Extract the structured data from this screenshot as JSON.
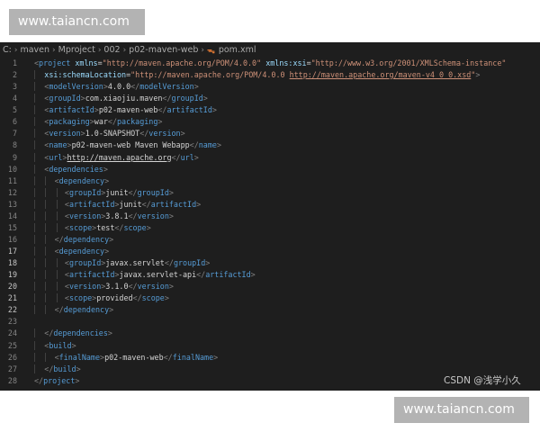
{
  "watermarks": {
    "top": "www.taiancn.com",
    "bottom": "www.taiancn.com"
  },
  "breadcrumb": [
    "C:",
    "maven",
    "Mproject",
    "002",
    "p02-maven-web",
    "pom.xml"
  ],
  "credit": "CSDN @浅学小久",
  "lines": [
    {
      "n": "1",
      "indent": 0,
      "tokens": [
        [
          "t",
          "<"
        ],
        [
          "tn",
          "project"
        ],
        [
          "tx",
          " "
        ],
        [
          "an",
          "xmlns"
        ],
        [
          "tx",
          "="
        ],
        [
          "av",
          "\"http://maven.apache.org/POM/4.0.0\""
        ],
        [
          "tx",
          " "
        ],
        [
          "an",
          "xmlns:xsi"
        ],
        [
          "tx",
          "="
        ],
        [
          "av",
          "\"http://www.w3.org/2001/XMLSchema-instance\""
        ]
      ]
    },
    {
      "n": "2",
      "indent": 1,
      "tokens": [
        [
          "an",
          "xsi:schemaLocation"
        ],
        [
          "tx",
          "="
        ],
        [
          "av",
          "\"http://maven.apache.org/POM/4.0.0 "
        ],
        [
          "av u",
          "http://maven.apache.org/maven-v4_0_0.xsd"
        ],
        [
          "av",
          "\""
        ],
        [
          "t",
          ">"
        ]
      ]
    },
    {
      "n": "3",
      "indent": 1,
      "tokens": [
        [
          "t",
          "<"
        ],
        [
          "tn",
          "modelVersion"
        ],
        [
          "t",
          ">"
        ],
        [
          "tx",
          "4.0.0"
        ],
        [
          "t",
          "</"
        ],
        [
          "tn",
          "modelVersion"
        ],
        [
          "t",
          ">"
        ]
      ]
    },
    {
      "n": "4",
      "indent": 1,
      "tokens": [
        [
          "t",
          "<"
        ],
        [
          "tn",
          "groupId"
        ],
        [
          "t",
          ">"
        ],
        [
          "tx",
          "com.xiaojiu.maven"
        ],
        [
          "t",
          "</"
        ],
        [
          "tn",
          "groupId"
        ],
        [
          "t",
          ">"
        ]
      ]
    },
    {
      "n": "5",
      "indent": 1,
      "tokens": [
        [
          "t",
          "<"
        ],
        [
          "tn",
          "artifactId"
        ],
        [
          "t",
          ">"
        ],
        [
          "tx",
          "p02-maven-web"
        ],
        [
          "t",
          "</"
        ],
        [
          "tn",
          "artifactId"
        ],
        [
          "t",
          ">"
        ]
      ]
    },
    {
      "n": "6",
      "indent": 1,
      "tokens": [
        [
          "t",
          "<"
        ],
        [
          "tn",
          "packaging"
        ],
        [
          "t",
          ">"
        ],
        [
          "tx",
          "war"
        ],
        [
          "t",
          "</"
        ],
        [
          "tn",
          "packaging"
        ],
        [
          "t",
          ">"
        ]
      ]
    },
    {
      "n": "7",
      "indent": 1,
      "tokens": [
        [
          "t",
          "<"
        ],
        [
          "tn",
          "version"
        ],
        [
          "t",
          ">"
        ],
        [
          "tx",
          "1.0-SNAPSHOT"
        ],
        [
          "t",
          "</"
        ],
        [
          "tn",
          "version"
        ],
        [
          "t",
          ">"
        ]
      ]
    },
    {
      "n": "8",
      "indent": 1,
      "tokens": [
        [
          "t",
          "<"
        ],
        [
          "tn",
          "name"
        ],
        [
          "t",
          ">"
        ],
        [
          "tx",
          "p02-maven-web Maven Webapp"
        ],
        [
          "t",
          "</"
        ],
        [
          "tn",
          "name"
        ],
        [
          "t",
          ">"
        ]
      ]
    },
    {
      "n": "9",
      "indent": 1,
      "tokens": [
        [
          "t",
          "<"
        ],
        [
          "tn",
          "url"
        ],
        [
          "t",
          ">"
        ],
        [
          "tx u",
          "http://maven.apache.org"
        ],
        [
          "t",
          "</"
        ],
        [
          "tn",
          "url"
        ],
        [
          "t",
          ">"
        ]
      ]
    },
    {
      "n": "10",
      "indent": 1,
      "tokens": [
        [
          "t",
          "<"
        ],
        [
          "tn",
          "dependencies"
        ],
        [
          "t",
          ">"
        ]
      ]
    },
    {
      "n": "11",
      "indent": 2,
      "tokens": [
        [
          "t",
          "<"
        ],
        [
          "tn",
          "dependency"
        ],
        [
          "t",
          ">"
        ]
      ]
    },
    {
      "n": "12",
      "indent": 3,
      "tokens": [
        [
          "t",
          "<"
        ],
        [
          "tn",
          "groupId"
        ],
        [
          "t",
          ">"
        ],
        [
          "tx",
          "junit"
        ],
        [
          "t",
          "</"
        ],
        [
          "tn",
          "groupId"
        ],
        [
          "t",
          ">"
        ]
      ]
    },
    {
      "n": "13",
      "indent": 3,
      "tokens": [
        [
          "t",
          "<"
        ],
        [
          "tn",
          "artifactId"
        ],
        [
          "t",
          ">"
        ],
        [
          "tx",
          "junit"
        ],
        [
          "t",
          "</"
        ],
        [
          "tn",
          "artifactId"
        ],
        [
          "t",
          ">"
        ]
      ]
    },
    {
      "n": "14",
      "indent": 3,
      "tokens": [
        [
          "t",
          "<"
        ],
        [
          "tn",
          "version"
        ],
        [
          "t",
          ">"
        ],
        [
          "tx",
          "3.8.1"
        ],
        [
          "t",
          "</"
        ],
        [
          "tn",
          "version"
        ],
        [
          "t",
          ">"
        ]
      ]
    },
    {
      "n": "15",
      "indent": 3,
      "tokens": [
        [
          "t",
          "<"
        ],
        [
          "tn",
          "scope"
        ],
        [
          "t",
          ">"
        ],
        [
          "tx",
          "test"
        ],
        [
          "t",
          "</"
        ],
        [
          "tn",
          "scope"
        ],
        [
          "t",
          ">"
        ]
      ]
    },
    {
      "n": "16",
      "indent": 2,
      "tokens": [
        [
          "t",
          "</"
        ],
        [
          "tn",
          "dependency"
        ],
        [
          "t",
          ">"
        ]
      ]
    },
    {
      "n": "17",
      "indent": 2,
      "sel": "full",
      "tokens": [
        [
          "t",
          "<"
        ],
        [
          "tn",
          "dependency"
        ],
        [
          "t",
          ">"
        ]
      ]
    },
    {
      "n": "18",
      "indent": 3,
      "sel": "dots",
      "tokens": [
        [
          "t",
          "<"
        ],
        [
          "tn",
          "groupId"
        ],
        [
          "t",
          ">"
        ],
        [
          "tx",
          "javax.servlet"
        ],
        [
          "t",
          "</"
        ],
        [
          "tn",
          "groupId"
        ],
        [
          "t",
          ">"
        ]
      ]
    },
    {
      "n": "19",
      "indent": 3,
      "sel": "dots",
      "tokens": [
        [
          "t",
          "<"
        ],
        [
          "tn",
          "artifactId"
        ],
        [
          "t",
          ">"
        ],
        [
          "tx",
          "javax.servlet-api"
        ],
        [
          "t",
          "</"
        ],
        [
          "tn",
          "artifactId"
        ],
        [
          "t",
          ">"
        ]
      ]
    },
    {
      "n": "20",
      "indent": 3,
      "sel": "dots",
      "tokens": [
        [
          "t",
          "<"
        ],
        [
          "tn",
          "version"
        ],
        [
          "t",
          ">"
        ],
        [
          "tx",
          "3.1.0"
        ],
        [
          "t",
          "</"
        ],
        [
          "tn",
          "version"
        ],
        [
          "t",
          ">"
        ]
      ]
    },
    {
      "n": "21",
      "indent": 3,
      "sel": "dots",
      "tokens": [
        [
          "t",
          "<"
        ],
        [
          "tn",
          "scope"
        ],
        [
          "t",
          ">"
        ],
        [
          "tx",
          "provided"
        ],
        [
          "t",
          "</"
        ],
        [
          "tn",
          "scope"
        ],
        [
          "t",
          ">"
        ]
      ]
    },
    {
      "n": "22",
      "indent": 2,
      "sel": "dots",
      "tokens": [
        [
          "t",
          "</"
        ],
        [
          "tn",
          "dependency"
        ],
        [
          "t",
          ">"
        ]
      ]
    },
    {
      "n": "23",
      "indent": 0,
      "tokens": []
    },
    {
      "n": "24",
      "indent": 1,
      "tokens": [
        [
          "t",
          "</"
        ],
        [
          "tn",
          "dependencies"
        ],
        [
          "t",
          ">"
        ]
      ]
    },
    {
      "n": "25",
      "indent": 1,
      "tokens": [
        [
          "t",
          "<"
        ],
        [
          "tn",
          "build"
        ],
        [
          "t",
          ">"
        ]
      ]
    },
    {
      "n": "26",
      "indent": 2,
      "tokens": [
        [
          "t",
          "<"
        ],
        [
          "tn",
          "finalName"
        ],
        [
          "t",
          ">"
        ],
        [
          "tx",
          "p02-maven-web"
        ],
        [
          "t",
          "</"
        ],
        [
          "tn",
          "finalName"
        ],
        [
          "t",
          ">"
        ]
      ]
    },
    {
      "n": "27",
      "indent": 1,
      "tokens": [
        [
          "t",
          "</"
        ],
        [
          "tn",
          "build"
        ],
        [
          "t",
          ">"
        ]
      ]
    },
    {
      "n": "28",
      "indent": 0,
      "tokens": [
        [
          "t",
          "</"
        ],
        [
          "tn",
          "project"
        ],
        [
          "t",
          ">"
        ]
      ]
    }
  ]
}
